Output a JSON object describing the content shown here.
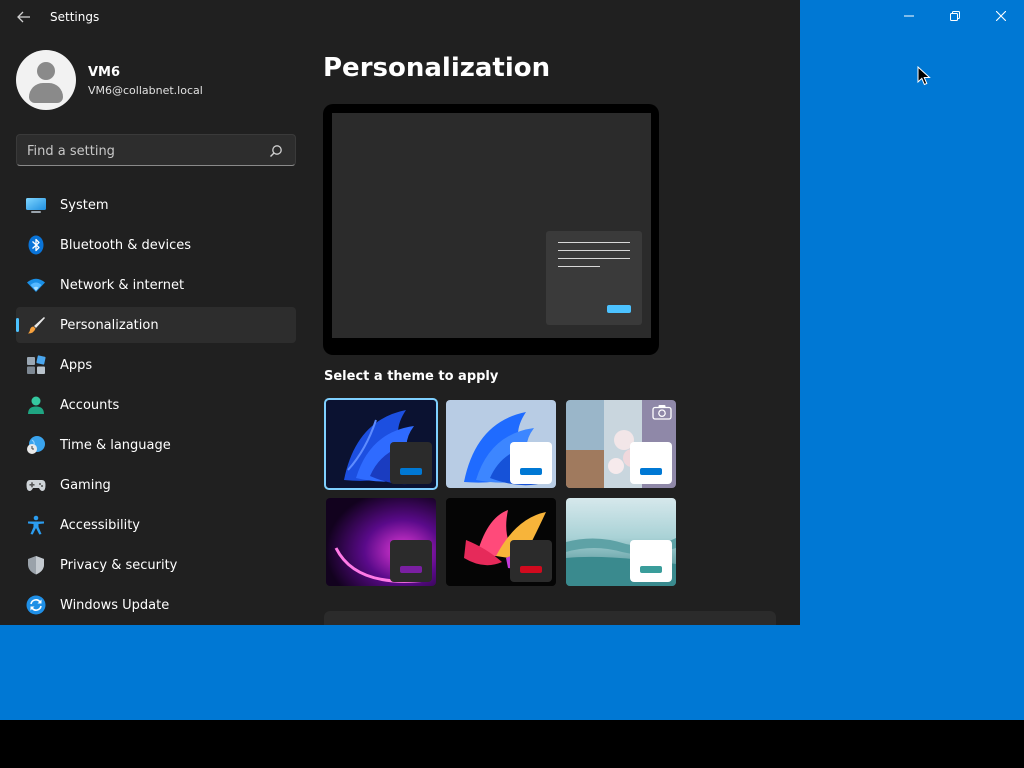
{
  "window": {
    "title": "Settings",
    "back_icon": "back-arrow-icon",
    "controls": [
      "minimize-icon",
      "maximize-icon",
      "close-icon"
    ]
  },
  "profile": {
    "name": "VM6",
    "email": "VM6@collabnet.local"
  },
  "search": {
    "placeholder": "Find a setting",
    "value": ""
  },
  "sidebar": {
    "items": [
      {
        "label": "System",
        "icon": "monitor-icon",
        "selected": false
      },
      {
        "label": "Bluetooth & devices",
        "icon": "bluetooth-icon",
        "selected": false
      },
      {
        "label": "Network & internet",
        "icon": "wifi-icon",
        "selected": false
      },
      {
        "label": "Personalization",
        "icon": "paintbrush-icon",
        "selected": true
      },
      {
        "label": "Apps",
        "icon": "apps-icon",
        "selected": false
      },
      {
        "label": "Accounts",
        "icon": "person-icon",
        "selected": false
      },
      {
        "label": "Time & language",
        "icon": "globe-clock-icon",
        "selected": false
      },
      {
        "label": "Gaming",
        "icon": "gamepad-icon",
        "selected": false
      },
      {
        "label": "Accessibility",
        "icon": "accessibility-icon",
        "selected": false
      },
      {
        "label": "Privacy & security",
        "icon": "shield-icon",
        "selected": false
      },
      {
        "label": "Windows Update",
        "icon": "update-icon",
        "selected": false
      }
    ]
  },
  "main": {
    "title": "Personalization",
    "theme_heading": "Select a theme to apply",
    "themes": [
      {
        "name": "windows-dark",
        "accent": "#0078d4",
        "mode": "dark",
        "selected": true
      },
      {
        "name": "windows-light",
        "accent": "#0078d4",
        "mode": "light",
        "selected": false
      },
      {
        "name": "windows-spotlight",
        "accent": "#0078d4",
        "mode": "light",
        "selected": false
      },
      {
        "name": "glow",
        "accent": "#7a1fa2",
        "mode": "dark",
        "selected": false
      },
      {
        "name": "captured-motion",
        "accent": "#d10a1e",
        "mode": "dark",
        "selected": false
      },
      {
        "name": "flow",
        "accent": "#3a9d9b",
        "mode": "light",
        "selected": false
      }
    ]
  },
  "colors": {
    "accent": "#4cc2ff",
    "desktop": "#0078d4",
    "window_bg": "#202020"
  }
}
